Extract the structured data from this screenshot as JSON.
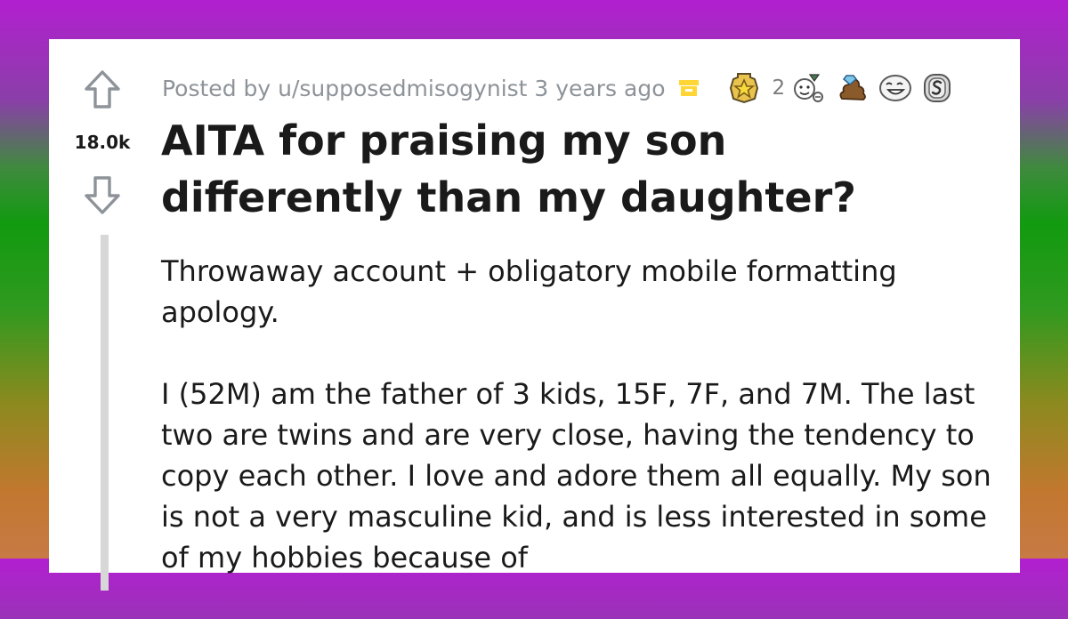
{
  "post": {
    "score": "18.0k",
    "meta": {
      "posted_by": "Posted by u/supposedmisogynist 3 years ago",
      "award_count": "2"
    },
    "title_line1": "AITA for praising my son",
    "title_line2": "differently than my daughter?",
    "body_paragraphs": [
      "Throwaway account + obligatory mobile formatting apology.",
      "I (52M) am the father of 3 kids, 15F, 7F, and 7M. The last two are twins and are very close, having the tendency to copy each other. I love and adore them all equally. My son is not a very masculine kid, and is less interested in some of my hobbies because of"
    ]
  },
  "icons": {
    "upvote": "upvote-arrow-icon",
    "downvote": "downvote-arrow-icon",
    "archived": "archive-box-icon",
    "awards": [
      "gold-star-award-icon",
      "wholesome-award-icon",
      "poop-diamond-award-icon",
      "laughing-face-award-icon",
      "silver-coin-award-icon"
    ]
  },
  "colors": {
    "text": "#1a1a1b",
    "meta": "#8d9399",
    "archive": "#ffd635",
    "thread_line": "#d7d7d7"
  }
}
